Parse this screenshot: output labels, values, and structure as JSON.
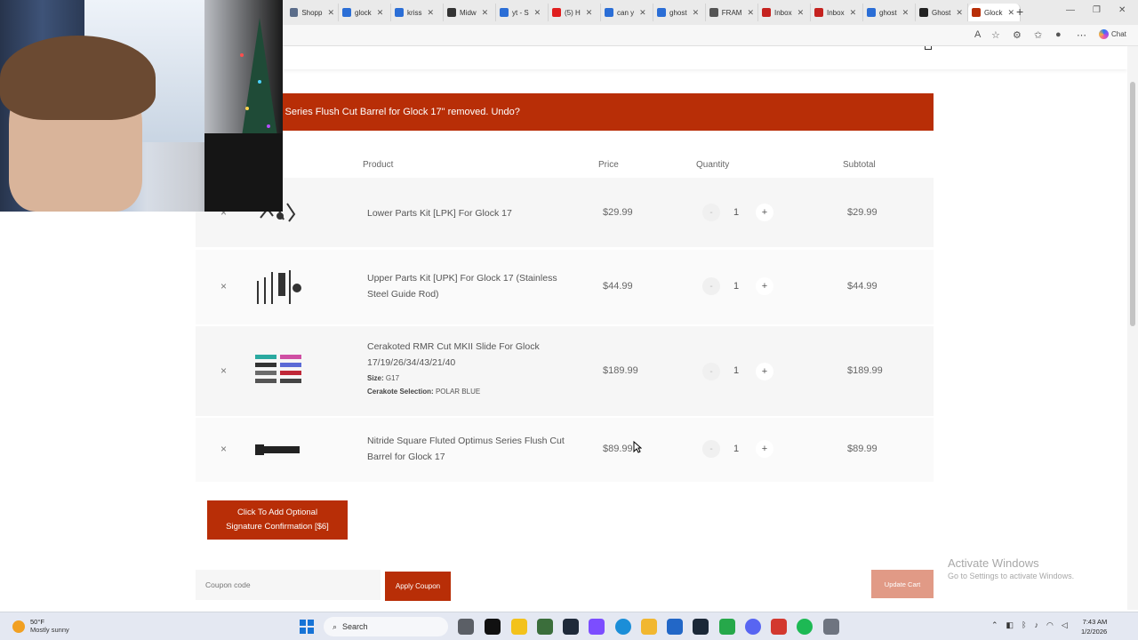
{
  "browser": {
    "tabs": [
      {
        "label": "Shopp",
        "color": "#5b6d8a"
      },
      {
        "label": "glock",
        "color": "#2b6ed6"
      },
      {
        "label": "kriss",
        "color": "#2b6ed6"
      },
      {
        "label": "Midw",
        "color": "#333333"
      },
      {
        "label": "yt - S",
        "color": "#2b6ed6"
      },
      {
        "label": "(5) H",
        "color": "#e01e1e"
      },
      {
        "label": "can y",
        "color": "#2b6ed6"
      },
      {
        "label": "ghost",
        "color": "#2b6ed6"
      },
      {
        "label": "FRAM",
        "color": "#555555"
      },
      {
        "label": "Inbox",
        "color": "#c5221f"
      },
      {
        "label": "Inbox",
        "color": "#c5221f"
      },
      {
        "label": "ghost",
        "color": "#2b6ed6"
      },
      {
        "label": "Ghost",
        "color": "#222222"
      },
      {
        "label": "Glock",
        "color": "#b82e07"
      }
    ],
    "new_tab": "+",
    "chat_label": "Chat"
  },
  "notice": {
    "text": "s Series Flush Cut Barrel for Glock 17\" removed. Undo?"
  },
  "table": {
    "headers": {
      "product": "Product",
      "price": "Price",
      "quantity": "Quantity",
      "subtotal": "Subtotal"
    },
    "rows": [
      {
        "name": "Lower Parts Kit [LPK] For Glock 17",
        "price": "$29.99",
        "qty": "1",
        "subtotal": "$29.99"
      },
      {
        "name": "Upper Parts Kit [UPK] For Glock 17 (Stainless Steel Guide Rod)",
        "price": "$44.99",
        "qty": "1",
        "subtotal": "$44.99"
      },
      {
        "name": "Cerakoted RMR Cut MKII Slide For Glock 17/19/26/34/43/21/40",
        "size_label": "Size:",
        "size_value": "G17",
        "cerakote_label": "Cerakote Selection:",
        "cerakote_value": "POLAR BLUE",
        "price": "$189.99",
        "qty": "1",
        "subtotal": "$189.99"
      },
      {
        "name": "Nitride Square Fluted Optimus Series Flush Cut Barrel for Glock 17",
        "price": "$89.99",
        "qty": "1",
        "subtotal": "$89.99"
      }
    ],
    "remove_symbol": "×",
    "minus_symbol": "-",
    "plus_symbol": "+"
  },
  "signature_button": {
    "line1": "Click To Add Optional",
    "line2": "Signature Confirmation [$6]"
  },
  "coupon": {
    "placeholder": "Coupon code",
    "apply_label": "Apply Coupon"
  },
  "update_cart_label": "Update Cart",
  "watermark": {
    "title": "Activate Windows",
    "subtitle": "Go to Settings to activate Windows."
  },
  "taskbar": {
    "temperature": "50°F",
    "weather": "Mostly sunny",
    "search_label": "Search",
    "time": "7:43 AM",
    "date": "1/2/2026"
  },
  "colors": {
    "accent": "#b82e07",
    "update_disabled": "#e19a86"
  }
}
